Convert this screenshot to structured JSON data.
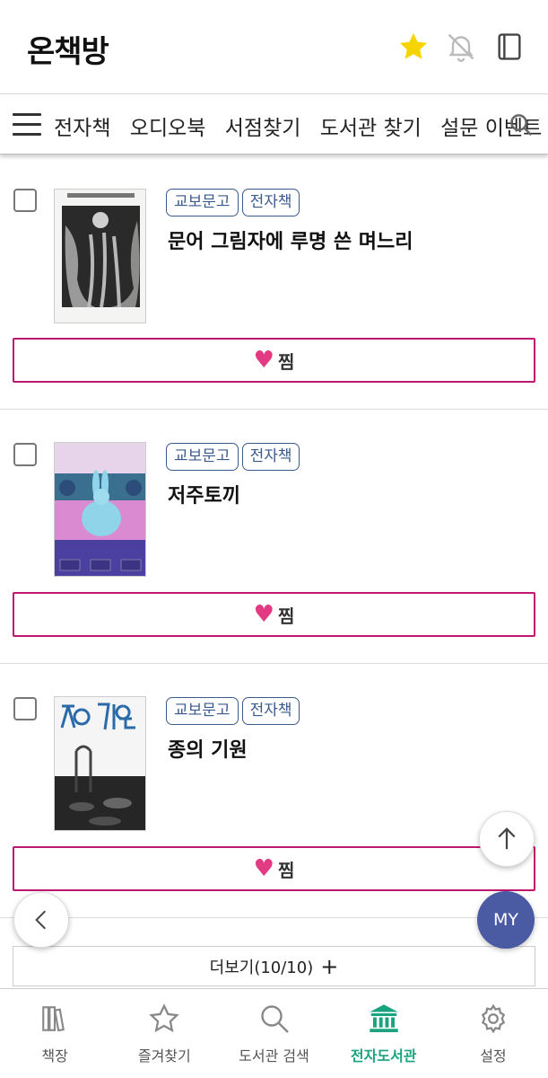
{
  "header": {
    "title": "온책방",
    "icons": [
      "star-icon",
      "bell-off-icon",
      "book-icon"
    ],
    "star_color": "#f5d400"
  },
  "nav": {
    "items": [
      "전자책",
      "오디오북",
      "서점찾기",
      "도서관 찾기",
      "설문 이벤트"
    ]
  },
  "books": [
    {
      "tags": [
        "교보문고",
        "전자책"
      ],
      "title": "문어 그림자에 루명 쓴 며느리",
      "wish_label": "찜"
    },
    {
      "tags": [
        "교보문고",
        "전자책"
      ],
      "title": "저주토끼",
      "wish_label": "찜"
    },
    {
      "tags": [
        "교보문고",
        "전자책"
      ],
      "title": "종의 기원",
      "wish_label": "찜"
    }
  ],
  "more": {
    "label": "더보기(10/10)",
    "icon": "+"
  },
  "fab": {
    "my_label": "MY"
  },
  "tabs": [
    {
      "label": "책장",
      "icon": "bookshelf-icon",
      "active": false
    },
    {
      "label": "즐겨찾기",
      "icon": "star-outline-icon",
      "active": false
    },
    {
      "label": "도서관 검색",
      "icon": "search-icon",
      "active": false
    },
    {
      "label": "전자도서관",
      "icon": "library-icon",
      "active": true
    },
    {
      "label": "설정",
      "icon": "gear-icon",
      "active": false
    }
  ],
  "colors": {
    "accent": "#1aa37f",
    "wish_border": "#c0186f",
    "heart": "#e23b84",
    "tag": "#3b5a8c",
    "my_button": "#4a5aa3"
  }
}
